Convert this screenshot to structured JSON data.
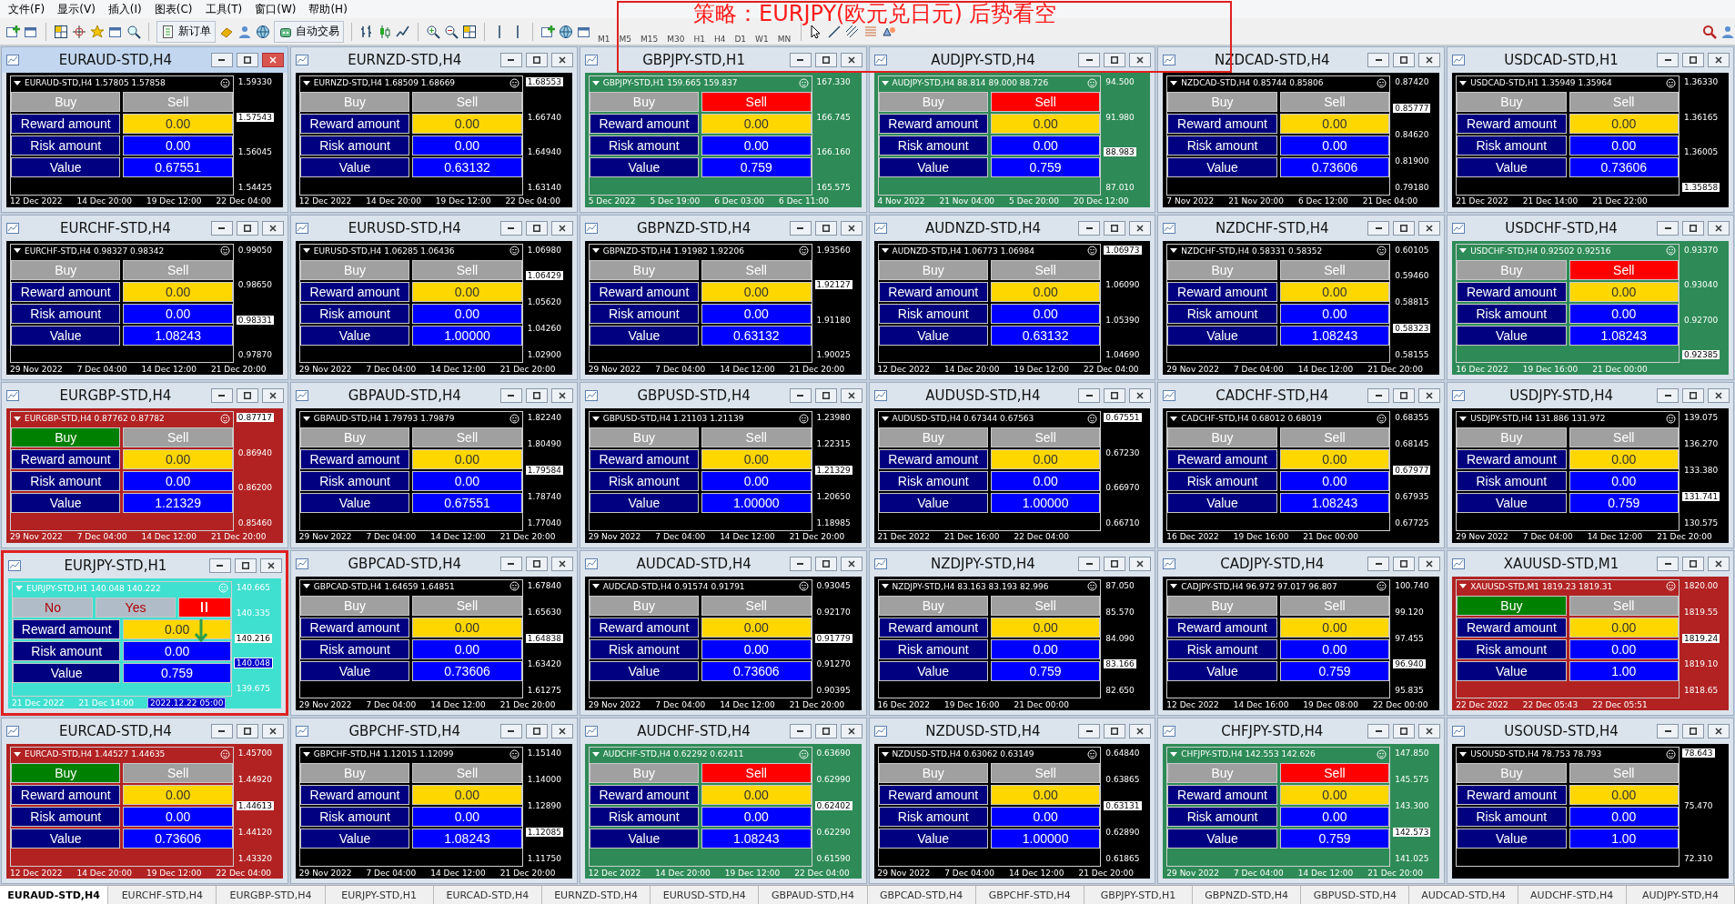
{
  "menu": [
    "文件(F)",
    "显示(V)",
    "插入(I)",
    "图表(C)",
    "工具(T)",
    "窗口(W)",
    "帮助(H)"
  ],
  "toolbar": {
    "buttons": [
      "新订单",
      "自动交易"
    ],
    "timeframes": [
      "M1",
      "M5",
      "M15",
      "M30",
      "H1",
      "H4",
      "D1",
      "W1",
      "MN"
    ]
  },
  "annotation": {
    "text": "策略：EURJPY(欧元兑日元) 后势看空"
  },
  "charts": [
    {
      "title": "EURAUD-STD,H4",
      "active": true,
      "highlighted": false,
      "color": "#000000",
      "header": "EURAUD-STD,H4 1.57805 1.57858",
      "buy": {
        "label": "Buy",
        "active": false
      },
      "sell": {
        "label": "Sell",
        "active": false
      },
      "rows": [
        {
          "label": "Reward amount",
          "value": "0.00",
          "kind": "reward"
        },
        {
          "label": "Risk amount",
          "value": "0.00",
          "kind": "risk"
        },
        {
          "label": "Value",
          "value": "0.67551",
          "kind": "value"
        }
      ],
      "axis": [
        {
          "text": "1.59330",
          "kind": "tick"
        },
        {
          "text": "1.57543",
          "kind": "price"
        },
        {
          "text": "1.56045",
          "kind": "tick"
        },
        {
          "text": "1.54425",
          "kind": "tick"
        }
      ],
      "dates": [
        "12 Dec 2022",
        "14 Dec 20:00",
        "19 Dec 12:00",
        "22 Dec 04:00"
      ]
    },
    {
      "title": "EURNZD-STD,H4",
      "active": false,
      "highlighted": false,
      "color": "#000000",
      "header": "EURNZD-STD,H4 1.68509 1.68669",
      "buy": {
        "label": "Buy",
        "active": false
      },
      "sell": {
        "label": "Sell",
        "active": false
      },
      "rows": [
        {
          "label": "Reward amount",
          "value": "0.00",
          "kind": "reward"
        },
        {
          "label": "Risk amount",
          "value": "0.00",
          "kind": "risk"
        },
        {
          "label": "Value",
          "value": "0.63132",
          "kind": "value"
        }
      ],
      "axis": [
        {
          "text": "1.68553",
          "kind": "price"
        },
        {
          "text": "1.66740",
          "kind": "tick"
        },
        {
          "text": "1.64940",
          "kind": "tick"
        },
        {
          "text": "1.63140",
          "kind": "tick"
        }
      ],
      "dates": [
        "12 Dec 2022",
        "14 Dec 20:00",
        "19 Dec 12:00",
        "22 Dec 04:00"
      ]
    },
    {
      "title": "GBPJPY-STD,H1",
      "active": false,
      "highlighted": false,
      "color": "#2e8b57",
      "header": "GBPJPY-STD,H1 159.665 159.837",
      "buy": {
        "label": "Buy",
        "active": false
      },
      "sell": {
        "label": "Sell",
        "active": true
      },
      "rows": [
        {
          "label": "Reward amount",
          "value": "0.00",
          "kind": "reward"
        },
        {
          "label": "Risk amount",
          "value": "0.00",
          "kind": "risk"
        },
        {
          "label": "Value",
          "value": "0.759",
          "kind": "value"
        }
      ],
      "axis": [
        {
          "text": "167.330",
          "kind": "tick"
        },
        {
          "text": "166.745",
          "kind": "tick"
        },
        {
          "text": "166.160",
          "kind": "tick"
        },
        {
          "text": "165.575",
          "kind": "tick"
        }
      ],
      "dates": [
        "5 Dec 2022",
        "5 Dec 19:00",
        "6 Dec 03:00",
        "6 Dec 11:00"
      ]
    },
    {
      "title": "AUDJPY-STD,H4",
      "active": false,
      "highlighted": false,
      "color": "#2e8b57",
      "header": "AUDJPY-STD,H4 88.814 89.000 88.726",
      "buy": {
        "label": "Buy",
        "active": false
      },
      "sell": {
        "label": "Sell",
        "active": true
      },
      "rows": [
        {
          "label": "Reward amount",
          "value": "0.00",
          "kind": "reward"
        },
        {
          "label": "Risk amount",
          "value": "0.00",
          "kind": "risk"
        },
        {
          "label": "Value",
          "value": "0.759",
          "kind": "value"
        }
      ],
      "axis": [
        {
          "text": "94.500",
          "kind": "tick"
        },
        {
          "text": "91.980",
          "kind": "tick"
        },
        {
          "text": "88.983",
          "kind": "price"
        },
        {
          "text": "87.010",
          "kind": "tick"
        }
      ],
      "dates": [
        "4 Nov 2022",
        "21 Nov 04:00",
        "5 Dec 20:00",
        "20 Dec 12:00"
      ]
    },
    {
      "title": "NZDCAD-STD,H4",
      "active": false,
      "highlighted": false,
      "color": "#000000",
      "header": "NZDCAD-STD,H4 0.85744 0.85806",
      "buy": {
        "label": "Buy",
        "active": false
      },
      "sell": {
        "label": "Sell",
        "active": false
      },
      "rows": [
        {
          "label": "Reward amount",
          "value": "0.00",
          "kind": "reward"
        },
        {
          "label": "Risk amount",
          "value": "0.00",
          "kind": "risk"
        },
        {
          "label": "Value",
          "value": "0.73606",
          "kind": "value"
        }
      ],
      "axis": [
        {
          "text": "0.87420",
          "kind": "tick"
        },
        {
          "text": "0.85777",
          "kind": "price"
        },
        {
          "text": "0.84620",
          "kind": "tick"
        },
        {
          "text": "0.81900",
          "kind": "tick"
        },
        {
          "text": "0.79180",
          "kind": "tick"
        }
      ],
      "dates": [
        "7 Nov 2022",
        "21 Nov 20:00",
        "6 Dec 12:00",
        "21 Dec 04:00"
      ]
    },
    {
      "title": "USDCAD-STD,H1",
      "active": false,
      "highlighted": false,
      "color": "#000000",
      "header": "USDCAD-STD,H1 1.35949 1.35964",
      "buy": {
        "label": "Buy",
        "active": false
      },
      "sell": {
        "label": "Sell",
        "active": false
      },
      "rows": [
        {
          "label": "Reward amount",
          "value": "0.00",
          "kind": "reward"
        },
        {
          "label": "Risk amount",
          "value": "0.00",
          "kind": "risk"
        },
        {
          "label": "Value",
          "value": "0.73606",
          "kind": "value"
        }
      ],
      "axis": [
        {
          "text": "1.36330",
          "kind": "tick"
        },
        {
          "text": "1.36165",
          "kind": "tick"
        },
        {
          "text": "1.36005",
          "kind": "tick"
        },
        {
          "text": "1.35858",
          "kind": "price"
        }
      ],
      "dates": [
        "21 Dec 2022",
        "21 Dec 14:00",
        "21 Dec 22:00"
      ]
    },
    {
      "title": "EURCHF-STD,H4",
      "active": false,
      "highlighted": false,
      "color": "#000000",
      "header": "EURCHF-STD,H4 0.98327 0.98342",
      "buy": {
        "label": "Buy",
        "active": false
      },
      "sell": {
        "label": "Sell",
        "active": false
      },
      "rows": [
        {
          "label": "Reward amount",
          "value": "0.00",
          "kind": "reward"
        },
        {
          "label": "Risk amount",
          "value": "0.00",
          "kind": "risk"
        },
        {
          "label": "Value",
          "value": "1.08243",
          "kind": "value"
        }
      ],
      "axis": [
        {
          "text": "0.99050",
          "kind": "tick"
        },
        {
          "text": "0.98650",
          "kind": "tick"
        },
        {
          "text": "0.98331",
          "kind": "price"
        },
        {
          "text": "0.97870",
          "kind": "tick"
        }
      ],
      "dates": [
        "29 Nov 2022",
        "7 Dec 04:00",
        "14 Dec 12:00",
        "21 Dec 20:00"
      ]
    },
    {
      "title": "EURUSD-STD,H4",
      "active": false,
      "highlighted": false,
      "color": "#000000",
      "header": "EURUSD-STD,H4 1.06285 1.06436",
      "buy": {
        "label": "Buy",
        "active": false
      },
      "sell": {
        "label": "Sell",
        "active": false
      },
      "rows": [
        {
          "label": "Reward amount",
          "value": "0.00",
          "kind": "reward"
        },
        {
          "label": "Risk amount",
          "value": "0.00",
          "kind": "risk"
        },
        {
          "label": "Value",
          "value": "1.00000",
          "kind": "value"
        }
      ],
      "axis": [
        {
          "text": "1.06980",
          "kind": "tick"
        },
        {
          "text": "1.06429",
          "kind": "price"
        },
        {
          "text": "1.05620",
          "kind": "tick"
        },
        {
          "text": "1.04260",
          "kind": "tick"
        },
        {
          "text": "1.02900",
          "kind": "tick"
        }
      ],
      "dates": [
        "29 Nov 2022",
        "7 Dec 04:00",
        "14 Dec 12:00",
        "21 Dec 20:00"
      ]
    },
    {
      "title": "GBPNZD-STD,H4",
      "active": false,
      "highlighted": false,
      "color": "#000000",
      "header": "GBPNZD-STD,H4 1.91982 1.92206",
      "buy": {
        "label": "Buy",
        "active": false
      },
      "sell": {
        "label": "Sell",
        "active": false
      },
      "rows": [
        {
          "label": "Reward amount",
          "value": "0.00",
          "kind": "reward"
        },
        {
          "label": "Risk amount",
          "value": "0.00",
          "kind": "risk"
        },
        {
          "label": "Value",
          "value": "0.63132",
          "kind": "value"
        }
      ],
      "axis": [
        {
          "text": "1.93560",
          "kind": "tick"
        },
        {
          "text": "1.92127",
          "kind": "price"
        },
        {
          "text": "1.91180",
          "kind": "tick"
        },
        {
          "text": "1.90025",
          "kind": "tick"
        }
      ],
      "dates": [
        "29 Nov 2022",
        "7 Dec 04:00",
        "14 Dec 12:00",
        "21 Dec 20:00"
      ]
    },
    {
      "title": "AUDNZD-STD,H4",
      "active": false,
      "highlighted": false,
      "color": "#000000",
      "header": "AUDNZD-STD,H4 1.06773 1.06984",
      "buy": {
        "label": "Buy",
        "active": false
      },
      "sell": {
        "label": "Sell",
        "active": false
      },
      "rows": [
        {
          "label": "Reward amount",
          "value": "0.00",
          "kind": "reward"
        },
        {
          "label": "Risk amount",
          "value": "0.00",
          "kind": "risk"
        },
        {
          "label": "Value",
          "value": "0.63132",
          "kind": "value"
        }
      ],
      "axis": [
        {
          "text": "1.06973",
          "kind": "price"
        },
        {
          "text": "1.06090",
          "kind": "tick"
        },
        {
          "text": "1.05390",
          "kind": "tick"
        },
        {
          "text": "1.04690",
          "kind": "tick"
        }
      ],
      "dates": [
        "12 Dec 2022",
        "14 Dec 20:00",
        "19 Dec 12:00",
        "22 Dec 04:00"
      ]
    },
    {
      "title": "NZDCHF-STD,H4",
      "active": false,
      "highlighted": false,
      "color": "#000000",
      "header": "NZDCHF-STD,H4 0.58331 0.58352",
      "buy": {
        "label": "Buy",
        "active": false
      },
      "sell": {
        "label": "Sell",
        "active": false
      },
      "rows": [
        {
          "label": "Reward amount",
          "value": "0.00",
          "kind": "reward"
        },
        {
          "label": "Risk amount",
          "value": "0.00",
          "kind": "risk"
        },
        {
          "label": "Value",
          "value": "1.08243",
          "kind": "value"
        }
      ],
      "axis": [
        {
          "text": "0.60105",
          "kind": "tick"
        },
        {
          "text": "0.59460",
          "kind": "tick"
        },
        {
          "text": "0.58815",
          "kind": "tick"
        },
        {
          "text": "0.58323",
          "kind": "price"
        },
        {
          "text": "0.58155",
          "kind": "tick"
        }
      ],
      "dates": [
        "29 Nov 2022",
        "7 Dec 04:00",
        "14 Dec 12:00",
        "21 Dec 20:00"
      ]
    },
    {
      "title": "USDCHF-STD,H4",
      "active": false,
      "highlighted": false,
      "color": "#2e8b57",
      "header": "USDCHF-STD,H4 0.92502 0.92516",
      "buy": {
        "label": "Buy",
        "active": false
      },
      "sell": {
        "label": "Sell",
        "active": true
      },
      "rows": [
        {
          "label": "Reward amount",
          "value": "0.00",
          "kind": "reward"
        },
        {
          "label": "Risk amount",
          "value": "0.00",
          "kind": "risk"
        },
        {
          "label": "Value",
          "value": "1.08243",
          "kind": "value"
        }
      ],
      "axis": [
        {
          "text": "0.93370",
          "kind": "tick"
        },
        {
          "text": "0.93040",
          "kind": "tick"
        },
        {
          "text": "0.92700",
          "kind": "tick"
        },
        {
          "text": "0.92385",
          "kind": "price"
        }
      ],
      "dates": [
        "16 Dec 2022",
        "19 Dec 16:00",
        "21 Dec 00:00"
      ]
    },
    {
      "title": "EURGBP-STD,H4",
      "active": false,
      "highlighted": false,
      "color": "#b22222",
      "header": "EURGBP-STD,H4 0.87762 0.87782",
      "buy": {
        "label": "Buy",
        "active": true
      },
      "sell": {
        "label": "Sell",
        "active": false
      },
      "rows": [
        {
          "label": "Reward amount",
          "value": "0.00",
          "kind": "reward"
        },
        {
          "label": "Risk amount",
          "value": "0.00",
          "kind": "risk"
        },
        {
          "label": "Value",
          "value": "1.21329",
          "kind": "value"
        }
      ],
      "axis": [
        {
          "text": "0.87717",
          "kind": "price"
        },
        {
          "text": "0.86940",
          "kind": "tick"
        },
        {
          "text": "0.86200",
          "kind": "tick"
        },
        {
          "text": "0.85460",
          "kind": "tick"
        }
      ],
      "dates": [
        "29 Nov 2022",
        "7 Dec 04:00",
        "14 Dec 12:00",
        "21 Dec 20:00"
      ]
    },
    {
      "title": "GBPAUD-STD,H4",
      "active": false,
      "highlighted": false,
      "color": "#000000",
      "header": "GBPAUD-STD,H4 1.79793 1.79879",
      "buy": {
        "label": "Buy",
        "active": false
      },
      "sell": {
        "label": "Sell",
        "active": false
      },
      "rows": [
        {
          "label": "Reward amount",
          "value": "0.00",
          "kind": "reward"
        },
        {
          "label": "Risk amount",
          "value": "0.00",
          "kind": "risk"
        },
        {
          "label": "Value",
          "value": "0.67551",
          "kind": "value"
        }
      ],
      "axis": [
        {
          "text": "1.82240",
          "kind": "tick"
        },
        {
          "text": "1.80490",
          "kind": "tick"
        },
        {
          "text": "1.79584",
          "kind": "price"
        },
        {
          "text": "1.78740",
          "kind": "tick"
        },
        {
          "text": "1.77040",
          "kind": "tick"
        }
      ],
      "dates": [
        "29 Nov 2022",
        "7 Dec 04:00",
        "14 Dec 12:00",
        "21 Dec 20:00"
      ]
    },
    {
      "title": "GBPUSD-STD,H4",
      "active": false,
      "highlighted": false,
      "color": "#000000",
      "header": "GBPUSD-STD,H4 1.21103 1.21139",
      "buy": {
        "label": "Buy",
        "active": false
      },
      "sell": {
        "label": "Sell",
        "active": false
      },
      "rows": [
        {
          "label": "Reward amount",
          "value": "0.00",
          "kind": "reward"
        },
        {
          "label": "Risk amount",
          "value": "0.00",
          "kind": "risk"
        },
        {
          "label": "Value",
          "value": "1.00000",
          "kind": "value"
        }
      ],
      "axis": [
        {
          "text": "1.23980",
          "kind": "tick"
        },
        {
          "text": "1.22315",
          "kind": "tick"
        },
        {
          "text": "1.21329",
          "kind": "price"
        },
        {
          "text": "1.20650",
          "kind": "tick"
        },
        {
          "text": "1.18985",
          "kind": "tick"
        }
      ],
      "dates": [
        "29 Nov 2022",
        "7 Dec 04:00",
        "14 Dec 12:00",
        "21 Dec 20:00"
      ]
    },
    {
      "title": "AUDUSD-STD,H4",
      "active": false,
      "highlighted": false,
      "color": "#000000",
      "header": "AUDUSD-STD,H4 0.67344 0.67563",
      "buy": {
        "label": "Buy",
        "active": false
      },
      "sell": {
        "label": "Sell",
        "active": false
      },
      "rows": [
        {
          "label": "Reward amount",
          "value": "0.00",
          "kind": "reward"
        },
        {
          "label": "Risk amount",
          "value": "0.00",
          "kind": "risk"
        },
        {
          "label": "Value",
          "value": "1.00000",
          "kind": "value"
        }
      ],
      "axis": [
        {
          "text": "0.67551",
          "kind": "price"
        },
        {
          "text": "0.67230",
          "kind": "tick"
        },
        {
          "text": "0.66970",
          "kind": "tick"
        },
        {
          "text": "0.66710",
          "kind": "tick"
        }
      ],
      "dates": [
        "21 Dec 2022",
        "21 Dec 16:00",
        "22 Dec 04:00"
      ]
    },
    {
      "title": "CADCHF-STD,H4",
      "active": false,
      "highlighted": false,
      "color": "#000000",
      "header": "CADCHF-STD,H4 0.68012 0.68019",
      "buy": {
        "label": "Buy",
        "active": false
      },
      "sell": {
        "label": "Sell",
        "active": false
      },
      "rows": [
        {
          "label": "Reward amount",
          "value": "0.00",
          "kind": "reward"
        },
        {
          "label": "Risk amount",
          "value": "0.00",
          "kind": "risk"
        },
        {
          "label": "Value",
          "value": "1.08243",
          "kind": "value"
        }
      ],
      "axis": [
        {
          "text": "0.68355",
          "kind": "tick"
        },
        {
          "text": "0.68145",
          "kind": "tick"
        },
        {
          "text": "0.67977",
          "kind": "price"
        },
        {
          "text": "0.67935",
          "kind": "tick"
        },
        {
          "text": "0.67725",
          "kind": "tick"
        }
      ],
      "dates": [
        "16 Dec 2022",
        "19 Dec 16:00",
        "21 Dec 00:00"
      ]
    },
    {
      "title": "USDJPY-STD,H4",
      "active": false,
      "highlighted": false,
      "color": "#000000",
      "header": "USDJPY-STD,H4 131.886 131.972",
      "buy": {
        "label": "Buy",
        "active": false
      },
      "sell": {
        "label": "Sell",
        "active": false
      },
      "rows": [
        {
          "label": "Reward amount",
          "value": "0.00",
          "kind": "reward"
        },
        {
          "label": "Risk amount",
          "value": "0.00",
          "kind": "risk"
        },
        {
          "label": "Value",
          "value": "0.759",
          "kind": "value"
        }
      ],
      "axis": [
        {
          "text": "139.075",
          "kind": "tick"
        },
        {
          "text": "136.270",
          "kind": "tick"
        },
        {
          "text": "133.380",
          "kind": "tick"
        },
        {
          "text": "131.741",
          "kind": "price"
        },
        {
          "text": "130.575",
          "kind": "tick"
        }
      ],
      "dates": [
        "29 Nov 2022",
        "7 Dec 04:00",
        "14 Dec 12:00",
        "21 Dec 20:00"
      ]
    },
    {
      "title": "EURJPY-STD,H1",
      "active": false,
      "highlighted": true,
      "color": "#40e0d0",
      "header": "EURJPY-STD,H1 140.048 140.222",
      "dialog": {
        "buttons": [
          "No",
          "Yes"
        ]
      },
      "sell": {
        "label": "ll",
        "active": true
      },
      "down_arrow": true,
      "rows": [
        {
          "label": "Reward amount",
          "value": "0.00",
          "kind": "reward"
        },
        {
          "label": "Risk amount",
          "value": "0.00",
          "kind": "risk"
        },
        {
          "label": "Value",
          "value": "0.759",
          "kind": "value"
        }
      ],
      "axis": [
        {
          "text": "140.665",
          "kind": "tick"
        },
        {
          "text": "140.335",
          "kind": "tick"
        },
        {
          "text": "140.216",
          "kind": "price"
        },
        {
          "text": "140.048",
          "kind": "cursor"
        },
        {
          "text": "139.675",
          "kind": "tick"
        }
      ],
      "dates": [
        "21 Dec 2022",
        "21 Dec 14:00"
      ],
      "cursor_time": "2022.12.22 05:00"
    },
    {
      "title": "GBPCAD-STD,H4",
      "active": false,
      "highlighted": false,
      "color": "#000000",
      "header": "GBPCAD-STD,H4 1.64659 1.64851",
      "buy": {
        "label": "Buy",
        "active": false
      },
      "sell": {
        "label": "Sell",
        "active": false
      },
      "rows": [
        {
          "label": "Reward amount",
          "value": "0.00",
          "kind": "reward"
        },
        {
          "label": "Risk amount",
          "value": "0.00",
          "kind": "risk"
        },
        {
          "label": "Value",
          "value": "0.73606",
          "kind": "value"
        }
      ],
      "axis": [
        {
          "text": "1.67840",
          "kind": "tick"
        },
        {
          "text": "1.65630",
          "kind": "tick"
        },
        {
          "text": "1.64838",
          "kind": "price"
        },
        {
          "text": "1.63420",
          "kind": "tick"
        },
        {
          "text": "1.61275",
          "kind": "tick"
        }
      ],
      "dates": [
        "29 Nov 2022",
        "7 Dec 04:00",
        "14 Dec 12:00",
        "21 Dec 20:00"
      ]
    },
    {
      "title": "AUDCAD-STD,H4",
      "active": false,
      "highlighted": false,
      "color": "#000000",
      "header": "AUDCAD-STD,H4 0.91574 0.91791",
      "buy": {
        "label": "Buy",
        "active": false
      },
      "sell": {
        "label": "Sell",
        "active": false
      },
      "rows": [
        {
          "label": "Reward amount",
          "value": "0.00",
          "kind": "reward"
        },
        {
          "label": "Risk amount",
          "value": "0.00",
          "kind": "risk"
        },
        {
          "label": "Value",
          "value": "0.73606",
          "kind": "value"
        }
      ],
      "axis": [
        {
          "text": "0.93045",
          "kind": "tick"
        },
        {
          "text": "0.92170",
          "kind": "tick"
        },
        {
          "text": "0.91779",
          "kind": "price"
        },
        {
          "text": "0.91270",
          "kind": "tick"
        },
        {
          "text": "0.90395",
          "kind": "tick"
        }
      ],
      "dates": [
        "29 Nov 2022",
        "7 Dec 04:00",
        "14 Dec 12:00",
        "21 Dec 20:00"
      ]
    },
    {
      "title": "NZDJPY-STD,H4",
      "active": false,
      "highlighted": false,
      "color": "#000000",
      "header": "NZDJPY-STD,H4 83.163 83.193 82.996",
      "buy": {
        "label": "Buy",
        "active": false
      },
      "sell": {
        "label": "Sell",
        "active": false
      },
      "rows": [
        {
          "label": "Reward amount",
          "value": "0.00",
          "kind": "reward"
        },
        {
          "label": "Risk amount",
          "value": "0.00",
          "kind": "risk"
        },
        {
          "label": "Value",
          "value": "0.759",
          "kind": "value"
        }
      ],
      "axis": [
        {
          "text": "87.050",
          "kind": "tick"
        },
        {
          "text": "85.570",
          "kind": "tick"
        },
        {
          "text": "84.090",
          "kind": "tick"
        },
        {
          "text": "83.166",
          "kind": "price"
        },
        {
          "text": "82.650",
          "kind": "tick"
        }
      ],
      "dates": [
        "16 Dec 2022",
        "19 Dec 16:00",
        "21 Dec 00:00"
      ]
    },
    {
      "title": "CADJPY-STD,H4",
      "active": false,
      "highlighted": false,
      "color": "#000000",
      "header": "CADJPY-STD,H4 96.972 97.017 96.807",
      "buy": {
        "label": "Buy",
        "active": false
      },
      "sell": {
        "label": "Sell",
        "active": false
      },
      "rows": [
        {
          "label": "Reward amount",
          "value": "0.00",
          "kind": "reward"
        },
        {
          "label": "Risk amount",
          "value": "0.00",
          "kind": "risk"
        },
        {
          "label": "Value",
          "value": "0.759",
          "kind": "value"
        }
      ],
      "axis": [
        {
          "text": "100.740",
          "kind": "tick"
        },
        {
          "text": "99.120",
          "kind": "tick"
        },
        {
          "text": "97.455",
          "kind": "tick"
        },
        {
          "text": "96.940",
          "kind": "price"
        },
        {
          "text": "95.835",
          "kind": "tick"
        }
      ],
      "dates": [
        "12 Dec 2022",
        "14 Dec 16:00",
        "19 Dec 08:00",
        "22 Dec 00:00"
      ]
    },
    {
      "title": "XAUUSD-STD,M1",
      "active": false,
      "highlighted": false,
      "color": "#b22222",
      "header": "XAUUSD-STD,M1 1819.23 1819.31",
      "buy": {
        "label": "Buy",
        "active": true
      },
      "sell": {
        "label": "Sell",
        "active": false
      },
      "rows": [
        {
          "label": "Reward amount",
          "value": "0.00",
          "kind": "reward"
        },
        {
          "label": "Risk amount",
          "value": "0.00",
          "kind": "risk"
        },
        {
          "label": "Value",
          "value": "1.00",
          "kind": "value"
        }
      ],
      "axis": [
        {
          "text": "1820.00",
          "kind": "tick"
        },
        {
          "text": "1819.55",
          "kind": "tick"
        },
        {
          "text": "1819.24",
          "kind": "price"
        },
        {
          "text": "1819.10",
          "kind": "tick"
        },
        {
          "text": "1818.65",
          "kind": "tick"
        }
      ],
      "dates": [
        "22 Dec 2022",
        "22 Dec 05:43",
        "22 Dec 05:51"
      ]
    },
    {
      "title": "EURCAD-STD,H4",
      "active": false,
      "highlighted": false,
      "color": "#b22222",
      "header": "EURCAD-STD,H4 1.44527 1.44635",
      "buy": {
        "label": "Buy",
        "active": true
      },
      "sell": {
        "label": "Sell",
        "active": false
      },
      "rows": [
        {
          "label": "Reward amount",
          "value": "0.00",
          "kind": "reward"
        },
        {
          "label": "Risk amount",
          "value": "0.00",
          "kind": "risk"
        },
        {
          "label": "Value",
          "value": "0.73606",
          "kind": "value"
        }
      ],
      "axis": [
        {
          "text": "1.45700",
          "kind": "tick"
        },
        {
          "text": "1.44920",
          "kind": "tick"
        },
        {
          "text": "1.44613",
          "kind": "price"
        },
        {
          "text": "1.44120",
          "kind": "tick"
        },
        {
          "text": "1.43320",
          "kind": "tick"
        }
      ],
      "dates": [
        "12 Dec 2022",
        "14 Dec 20:00",
        "19 Dec 12:00",
        "22 Dec 04:00"
      ]
    },
    {
      "title": "GBPCHF-STD,H4",
      "active": false,
      "highlighted": false,
      "color": "#000000",
      "header": "GBPCHF-STD,H4 1.12015 1.12099",
      "buy": {
        "label": "Buy",
        "active": false
      },
      "sell": {
        "label": "Sell",
        "active": false
      },
      "rows": [
        {
          "label": "Reward amount",
          "value": "0.00",
          "kind": "reward"
        },
        {
          "label": "Risk amount",
          "value": "0.00",
          "kind": "risk"
        },
        {
          "label": "Value",
          "value": "1.08243",
          "kind": "value"
        }
      ],
      "axis": [
        {
          "text": "1.15140",
          "kind": "tick"
        },
        {
          "text": "1.14000",
          "kind": "tick"
        },
        {
          "text": "1.12890",
          "kind": "tick"
        },
        {
          "text": "1.12085",
          "kind": "price"
        },
        {
          "text": "1.11750",
          "kind": "tick"
        }
      ],
      "dates": [
        "29 Nov 2022",
        "7 Dec 04:00",
        "14 Dec 12:00",
        "21 Dec 20:00"
      ]
    },
    {
      "title": "AUDCHF-STD,H4",
      "active": false,
      "highlighted": false,
      "color": "#2e8b57",
      "header": "AUDCHF-STD,H4 0.62292 0.62411",
      "buy": {
        "label": "Buy",
        "active": false
      },
      "sell": {
        "label": "Sell",
        "active": true
      },
      "rows": [
        {
          "label": "Reward amount",
          "value": "0.00",
          "kind": "reward"
        },
        {
          "label": "Risk amount",
          "value": "0.00",
          "kind": "risk"
        },
        {
          "label": "Value",
          "value": "1.08243",
          "kind": "value"
        }
      ],
      "axis": [
        {
          "text": "0.63690",
          "kind": "tick"
        },
        {
          "text": "0.62990",
          "kind": "tick"
        },
        {
          "text": "0.62402",
          "kind": "price"
        },
        {
          "text": "0.62290",
          "kind": "tick"
        },
        {
          "text": "0.61590",
          "kind": "tick"
        }
      ],
      "dates": [
        "12 Dec 2022",
        "14 Dec 20:00",
        "19 Dec 12:00",
        "22 Dec 04:00"
      ]
    },
    {
      "title": "NZDUSD-STD,H4",
      "active": false,
      "highlighted": false,
      "color": "#000000",
      "header": "NZDUSD-STD,H4 0.63062 0.63149",
      "buy": {
        "label": "Buy",
        "active": false
      },
      "sell": {
        "label": "Sell",
        "active": false
      },
      "rows": [
        {
          "label": "Reward amount",
          "value": "0.00",
          "kind": "reward"
        },
        {
          "label": "Risk amount",
          "value": "0.00",
          "kind": "risk"
        },
        {
          "label": "Value",
          "value": "1.00000",
          "kind": "value"
        }
      ],
      "axis": [
        {
          "text": "0.64840",
          "kind": "tick"
        },
        {
          "text": "0.63865",
          "kind": "tick"
        },
        {
          "text": "0.63131",
          "kind": "price"
        },
        {
          "text": "0.62890",
          "kind": "tick"
        },
        {
          "text": "0.61865",
          "kind": "tick"
        }
      ],
      "dates": [
        "29 Nov 2022",
        "7 Dec 04:00",
        "14 Dec 12:00",
        "21 Dec 20:00"
      ]
    },
    {
      "title": "CHFJPY-STD,H4",
      "active": false,
      "highlighted": false,
      "color": "#2e8b57",
      "header": "CHFJPY-STD,H4 142.553 142.626",
      "buy": {
        "label": "Buy",
        "active": false
      },
      "sell": {
        "label": "Sell",
        "active": true
      },
      "rows": [
        {
          "label": "Reward amount",
          "value": "0.00",
          "kind": "reward"
        },
        {
          "label": "Risk amount",
          "value": "0.00",
          "kind": "risk"
        },
        {
          "label": "Value",
          "value": "0.759",
          "kind": "value"
        }
      ],
      "axis": [
        {
          "text": "147.850",
          "kind": "tick"
        },
        {
          "text": "145.575",
          "kind": "tick"
        },
        {
          "text": "143.300",
          "kind": "tick"
        },
        {
          "text": "142.573",
          "kind": "price"
        },
        {
          "text": "141.025",
          "kind": "tick"
        }
      ],
      "dates": [
        "29 Nov 2022",
        "7 Dec 04:00",
        "14 Dec 12:00",
        "21 Dec 20:00"
      ]
    },
    {
      "title": "USOUSD-STD,H4",
      "active": false,
      "highlighted": false,
      "color": "#000000",
      "header": "USOUSD-STD,H4 78.753 78.793",
      "buy": {
        "label": "Buy",
        "active": false
      },
      "sell": {
        "label": "Sell",
        "active": false
      },
      "rows": [
        {
          "label": "Reward amount",
          "value": "0.00",
          "kind": "reward"
        },
        {
          "label": "Risk amount",
          "value": "0.00",
          "kind": "risk"
        },
        {
          "label": "Value",
          "value": "1.00",
          "kind": "value"
        }
      ],
      "axis": [
        {
          "text": "78.643",
          "kind": "price"
        },
        {
          "text": "75.470",
          "kind": "tick"
        },
        {
          "text": "72.310",
          "kind": "tick"
        }
      ]
    }
  ],
  "tabs": [
    {
      "label": "EURAUD-STD,H4",
      "selected": true
    },
    {
      "label": "EURCHF-STD,H4",
      "selected": false
    },
    {
      "label": "EURGBP-STD,H4",
      "selected": false
    },
    {
      "label": "EURJPY-STD,H1",
      "selected": false
    },
    {
      "label": "EURCAD-STD,H4",
      "selected": false
    },
    {
      "label": "EURNZD-STD,H4",
      "selected": false
    },
    {
      "label": "EURUSD-STD,H4",
      "selected": false
    },
    {
      "label": "GBPAUD-STD,H4",
      "selected": false
    },
    {
      "label": "GBPCAD-STD,H4",
      "selected": false
    },
    {
      "label": "GBPCHF-STD,H4",
      "selected": false
    },
    {
      "label": "GBPJPY-STD,H1",
      "selected": false
    },
    {
      "label": "GBPNZD-STD,H4",
      "selected": false
    },
    {
      "label": "GBPUSD-STD,H4",
      "selected": false
    },
    {
      "label": "AUDCAD-STD,H4",
      "selected": false
    },
    {
      "label": "AUDCHF-STD,H4",
      "selected": false
    },
    {
      "label": "AUDJPY-STD,H4",
      "selected": false
    }
  ]
}
